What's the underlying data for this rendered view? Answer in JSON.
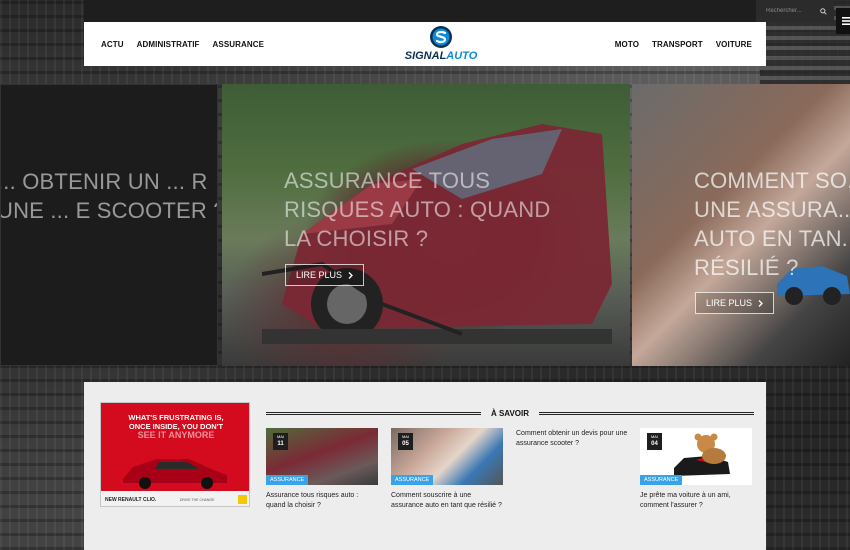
{
  "search": {
    "placeholder": "Rechercher..."
  },
  "nav": {
    "left": [
      "ACTU",
      "ADMINISTRATIF",
      "ASSURANCE"
    ],
    "right": [
      "MOTO",
      "TRANSPORT",
      "VOITURE"
    ]
  },
  "logo": {
    "part1": "SIGNAL",
    "part2": "AUTO"
  },
  "slides": [
    {
      "title": "... obtenir un ... r une ... e scooter ?"
    },
    {
      "title": "Assurance tous risques auto : quand la choisir ?",
      "cta": "LIRE PLUS"
    },
    {
      "title": "Comment so... à une assura... auto en tan... résilié ?",
      "cta": "LIRE PLUS"
    }
  ],
  "ad": {
    "headline1": "WHAT'S FRUSTRATING IS,",
    "headline2": "ONCE INSIDE, YOU DON'T",
    "headline3": "SEE IT ANYMORE",
    "model": "NEW RENAULT CLIO.",
    "drive": "DRIVE THE CHANGE"
  },
  "section": {
    "title": "À SAVOIR"
  },
  "cards": [
    {
      "month": "MAI",
      "day": "11",
      "tag": "ASSURANCE",
      "title": "Assurance tous risques auto : quand la choisir ?"
    },
    {
      "month": "MAI",
      "day": "05",
      "tag": "ASSURANCE",
      "title": "Comment souscrire à une assurance auto en tant que résilié ?"
    },
    {
      "title": "Comment obtenir un devis pour une assurance scooter ?"
    },
    {
      "month": "MAI",
      "day": "04",
      "tag": "ASSURANCE",
      "title": "Je prête ma voiture à un ami, comment l'assurer ?"
    }
  ],
  "colors": {
    "accent": "#3aa3e8",
    "logo_dark": "#0b2f57",
    "logo_blue": "#0a8bd6"
  }
}
